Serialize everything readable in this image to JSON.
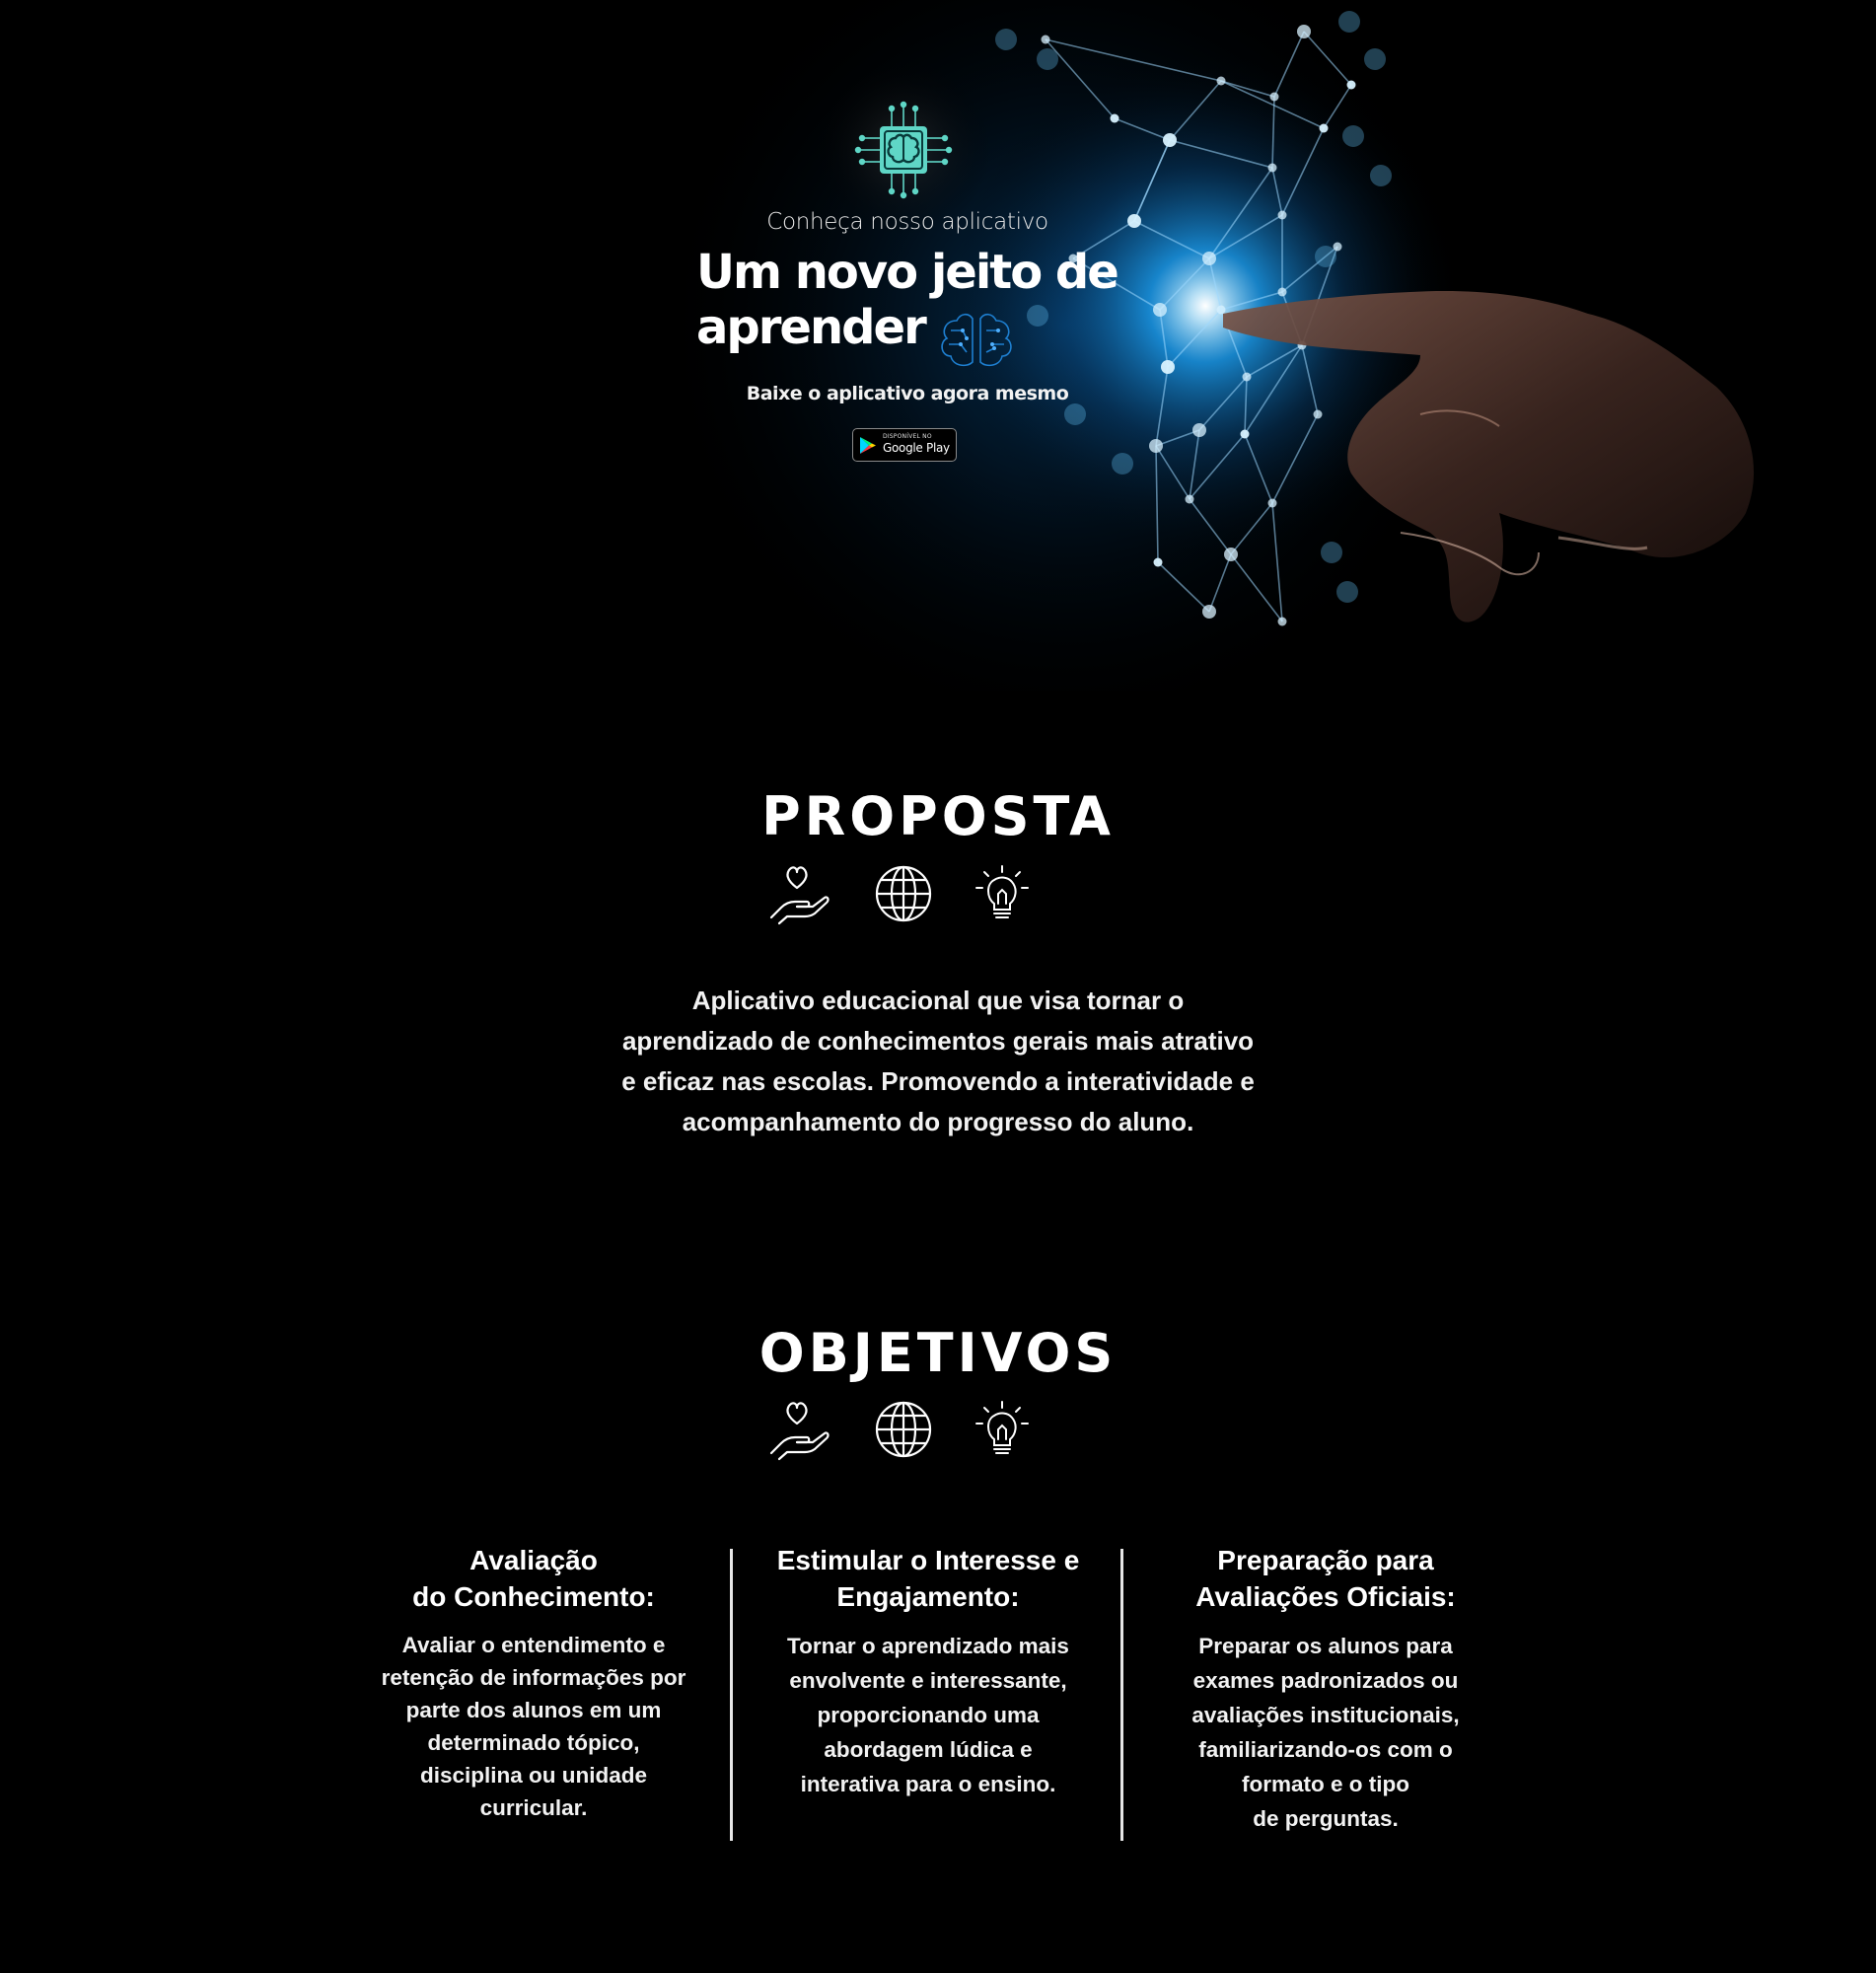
{
  "hero": {
    "kicker": "Conheça nosso aplicativo",
    "title_line1": "Um novo jeito de",
    "title_line2": "aprender",
    "subtitle": "Baixe o aplicativo agora mesmo",
    "store_badge": {
      "small_text": "DISPONÍVEL NO",
      "store_name": "Google Play"
    },
    "logo_icon": "brain-chip-icon",
    "title_icon": "brain-icon"
  },
  "proposta": {
    "title": "PROPOSTA",
    "icons": [
      "heart-hand-icon",
      "globe-icon",
      "lightbulb-icon"
    ],
    "lines": [
      "Aplicativo educacional que visa tornar o",
      "aprendizado de conhecimentos gerais mais atrativo",
      "e eficaz nas escolas. Promovendo a interatividade e",
      "acompanhamento do progresso do aluno."
    ]
  },
  "objetivos": {
    "title": "OBJETIVOS",
    "icons": [
      "heart-hand-icon",
      "globe-icon",
      "lightbulb-icon"
    ],
    "items": [
      {
        "title_lines": [
          "Avaliação",
          "do Conhecimento:"
        ],
        "text_lines": [
          "Avaliar o entendimento e",
          "retenção de informações por",
          "parte dos alunos em um",
          "determinado tópico,",
          "disciplina ou unidade",
          "curricular."
        ]
      },
      {
        "title_lines": [
          "Estimular o Interesse e",
          "Engajamento:"
        ],
        "text_lines": [
          "Tornar o aprendizado mais",
          "envolvente e interessante,",
          "proporcionando uma",
          "abordagem lúdica e",
          "interativa para o ensino."
        ]
      },
      {
        "title_lines": [
          "Preparação para",
          "Avaliações Oficiais:"
        ],
        "text_lines": [
          "Preparar os alunos para",
          "exames padronizados ou",
          "avaliações institucionais,",
          "familiarizando-os com o",
          "formato e o tipo",
          "de perguntas."
        ]
      }
    ]
  },
  "colors": {
    "background": "#000000",
    "text": "#ffffff",
    "glow": "#1ea8ff",
    "logo_teal": "#5fd6c6"
  }
}
